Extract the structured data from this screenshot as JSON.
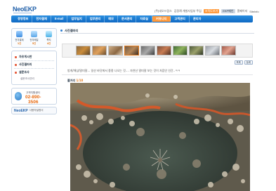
{
  "brand": {
    "logo_neo": "Neo",
    "logo_ekp": "EKP"
  },
  "toplinks": {
    "company": "(주)네오드림스",
    "user": "김정례 개발사업부 주임",
    "badge": "조직도보기",
    "links": [
      "EKP메인",
      "홈페이지",
      "Sitelnfo"
    ]
  },
  "nav": {
    "items": [
      "경영정보",
      "전자결재",
      "E-mail",
      "업무일지",
      "업무관리",
      "메모",
      "문서관리",
      "자료실",
      "커뮤니티",
      "고객관리",
      "관리자"
    ],
    "active_index": 8
  },
  "quick": [
    {
      "label": "전자결재",
      "count": "1건"
    },
    {
      "label": "전자메일",
      "count": "5건"
    },
    {
      "label": "쪽지",
      "count": "4건"
    }
  ],
  "menu": {
    "items": [
      "자유게시판",
      "사진갤러리",
      "설문조사"
    ],
    "sub": "설문조사관리"
  },
  "cs": {
    "label": "고객지원센터",
    "phone1": "02-890-",
    "phone2": "3506"
  },
  "banner": {
    "brand": "NeoEKP",
    "text": "사용자설명서"
  },
  "content": {
    "title": "사진갤러리",
    "buttons": [
      "목록",
      "등록"
    ],
    "description": "방게/해삼/말미잘... 일산 바닷에서 종종 나오는 것.... 자연산 말미잘 보는 것이 처음인 인간..ㅋㅋ",
    "photo_label": "볼거리",
    "photo_count": "1/10"
  },
  "colors": {
    "accent": "#1f5fa8",
    "nav_active": "#ff9a3c",
    "phone": "#e86b12"
  }
}
